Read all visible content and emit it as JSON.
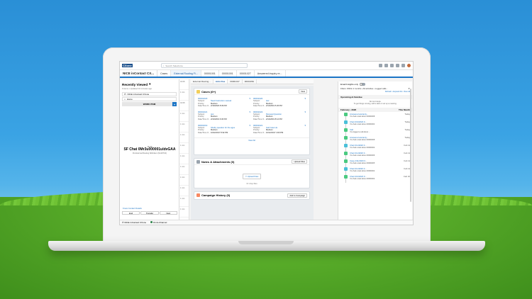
{
  "colors": {
    "brand": "#1b74c5",
    "success": "#4bca81",
    "sky": "#2a8fd6",
    "grass": "#5aae2a"
  },
  "header": {
    "logo_text": "CXone",
    "search_placeholder": "Search Salesforce"
  },
  "nav": {
    "app_name": "NICE inContact CX...",
    "tabs": [
      "Cases",
      "External Routing Fi...",
      "00001001",
      "00001001",
      "00001027",
      "Answered inquiry re..."
    ]
  },
  "subnav": {
    "tabs": [
      "External Routing...",
      "John Doe",
      "00001017",
      "00001052"
    ]
  },
  "left": {
    "title": "Recently Viewed",
    "meta": "9 items • Updated 10 minutes ago",
    "items": [
      "NICE inContact CXone",
      "Home"
    ],
    "work_item": "WORK ITEM",
    "chat": {
      "time": "16:26",
      "title": "SF Chat 0Mr3u000001uldvGAA",
      "sub": "RL External Routing Workitem (6m20710)"
    },
    "footer_link": "Know Contact Details",
    "buttons": [
      "End",
      "Transfer",
      "Next"
    ]
  },
  "times": [
    "02:08",
    "1 min",
    "02:08",
    "1 min",
    "1 min",
    "1 min",
    "1 min",
    "1 min",
    "1 min",
    "1 min",
    "1 min",
    "1 min",
    "1 min"
  ],
  "cases_card": {
    "title": "Cases (6+)",
    "new_button": "New",
    "labels": {
      "subject": "Subject:",
      "priority": "Priority:",
      "opened": "Date/Time O..."
    },
    "cases": [
      {
        "number": "00001018",
        "subject": "Need Instruction manual",
        "priority": "Medium",
        "opened": "2/19/2020 8:39 PM"
      },
      {
        "number": "00001020",
        "subject": "test",
        "priority": "Medium",
        "opened": "2/12/2019 5:26 PM"
      },
      {
        "number": "00001021",
        "subject": "test",
        "priority": "Medium",
        "opened": "2/10/2019 6:30 PM"
      },
      {
        "number": "00001022",
        "subject": "Renewal Question",
        "priority": "Medium",
        "opened": "2/12/2019 8:12 PM"
      },
      {
        "number": "00001019",
        "subject": "Shelby question for the ages",
        "priority": "Medium",
        "opened": "10/22/2017 8:32 PM"
      },
      {
        "number": "00001021",
        "subject": "Gail Case Ha",
        "priority": "Medium",
        "opened": "10/12/2017 4:00 PM"
      }
    ],
    "view_all": "View All"
  },
  "notes_card": {
    "title": "Notes & Attachments (0)",
    "upload_button": "Upload Files",
    "upload_label": "Upload Files",
    "drop": "Or drop files"
  },
  "campaign_card": {
    "title": "Campaign History (0)",
    "add_button": "Add to Campaign"
  },
  "right": {
    "toggle_label": "Email Insights only",
    "filters": "Filters: Within 2 months • All activities • Logged calls...",
    "links": "Refresh • Expand All • View All",
    "upcoming": "Upcoming & Overdue",
    "no_steps": "No next steps.",
    "no_steps_sub": "To get things moving, add a task or set up a meeting.",
    "month": "February • 2020",
    "month_right": "This Month",
    "activities": [
      {
        "title": "Answered warranty...",
        "date": "Today",
        "sub": "You had a task about 00000008"
      },
      {
        "title": "Chat 2/19/2020 0...",
        "date": "Today",
        "sub": "You had a task about 00000004"
      },
      {
        "title": "Call",
        "date": "Today",
        "sub": "You logged a call about ..."
      },
      {
        "title": "Answered warranty...",
        "date": "Today",
        "sub": "You had a task about 00000008"
      },
      {
        "title": "Chat 2/11/2020 0...",
        "date": "Feb 11",
        "sub": "You had a task about 00000002"
      },
      {
        "title": "Chat 2/11/2020 0...",
        "date": "Feb 11",
        "sub": "You had a task about 00000006"
      },
      {
        "title": "Case 2/11/2020 0...",
        "date": "Feb 11",
        "sub": "You had a task about 00000005"
      },
      {
        "title": "Chat 2/11/2020 0...",
        "date": "Feb 11",
        "sub": "You had a task about 00000002"
      },
      {
        "title": "Chat 2/10/2020 0...",
        "date": "Feb 10",
        "sub": "You had a task about 00000002"
      }
    ]
  },
  "utility": {
    "items": [
      "NICE inContact CXone",
      "Omni-Channel"
    ]
  }
}
